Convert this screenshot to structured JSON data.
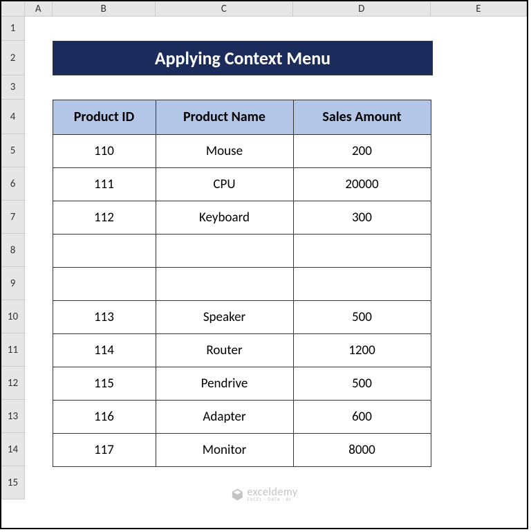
{
  "columns": [
    "A",
    "B",
    "C",
    "D",
    "E"
  ],
  "rows": [
    "1",
    "2",
    "3",
    "4",
    "5",
    "6",
    "7",
    "8",
    "9",
    "10",
    "11",
    "12",
    "13",
    "14",
    "15"
  ],
  "title": "Applying Context Menu",
  "headers": {
    "col1": "Product ID",
    "col2": "Product Name",
    "col3": "Sales Amount"
  },
  "data": [
    {
      "id": "110",
      "name": "Mouse",
      "amount": "200"
    },
    {
      "id": "111",
      "name": "CPU",
      "amount": "20000"
    },
    {
      "id": "112",
      "name": "Keyboard",
      "amount": "300"
    },
    {
      "id": "",
      "name": "",
      "amount": ""
    },
    {
      "id": "",
      "name": "",
      "amount": ""
    },
    {
      "id": "113",
      "name": "Speaker",
      "amount": "500"
    },
    {
      "id": "114",
      "name": "Router",
      "amount": "1200"
    },
    {
      "id": "115",
      "name": "Pendrive",
      "amount": "500"
    },
    {
      "id": "116",
      "name": "Adapter",
      "amount": "600"
    },
    {
      "id": "117",
      "name": "Monitor",
      "amount": "8000"
    }
  ],
  "watermark": {
    "main": "exceldemy",
    "sub": "EXCEL · DATA · BI"
  }
}
